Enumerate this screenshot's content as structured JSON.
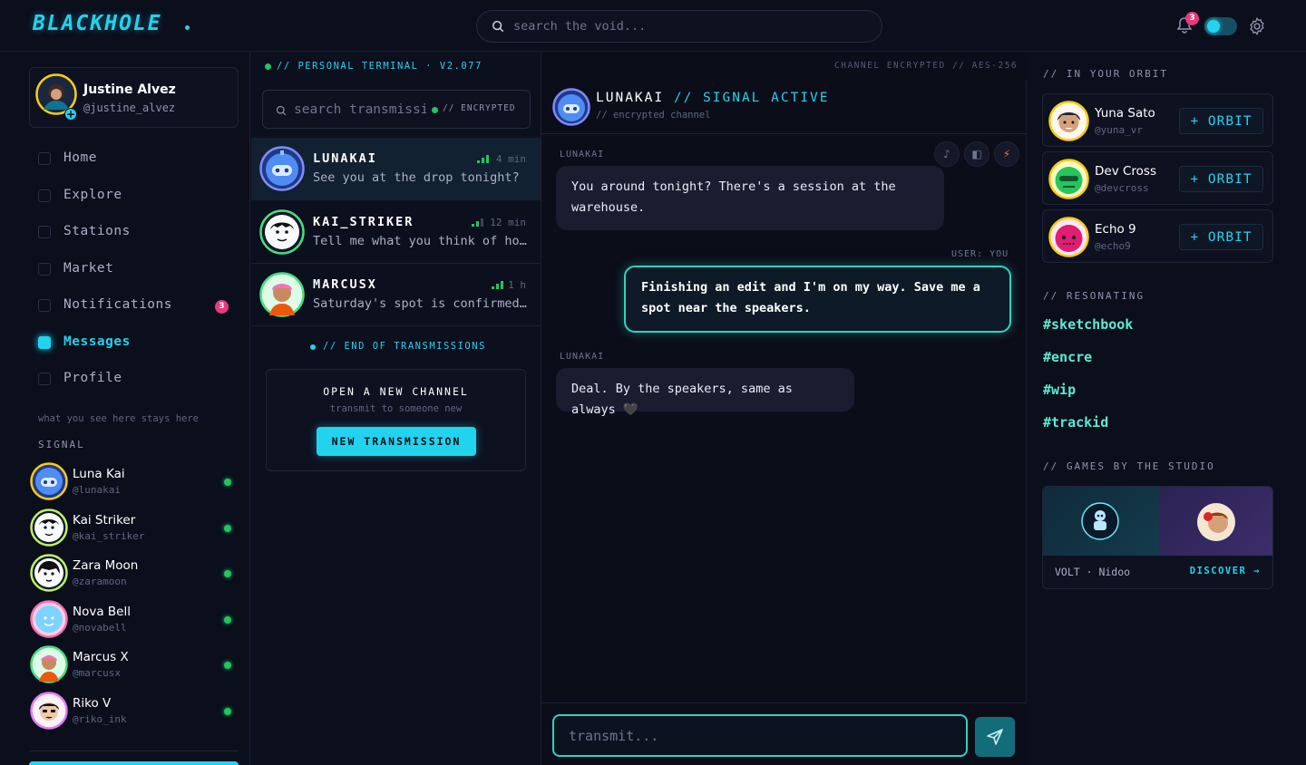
{
  "app": {
    "logo": "BLACKHOLE",
    "search_placeholder": "search the void...",
    "notification_count": "3",
    "theme_toggle": "on"
  },
  "profile": {
    "name": "Justine Alvez",
    "handle": "@justine_alvez"
  },
  "nav": {
    "items": [
      {
        "label": "Home"
      },
      {
        "label": "Explore"
      },
      {
        "label": "Stations"
      },
      {
        "label": "Market"
      },
      {
        "label": "Notifications",
        "badge": "3"
      },
      {
        "label": "Messages",
        "active": true
      },
      {
        "label": "Profile"
      }
    ]
  },
  "left_note": "what you see here stays here",
  "signal": {
    "heading": "SIGNAL",
    "users": [
      {
        "name": "Luna Kai",
        "handle": "@lunakai"
      },
      {
        "name": "Kai Striker",
        "handle": "@kai_striker"
      },
      {
        "name": "Zara Moon",
        "handle": "@zaramoon"
      },
      {
        "name": "Nova Bell",
        "handle": "@novabell"
      },
      {
        "name": "Marcus X",
        "handle": "@marcusx"
      },
      {
        "name": "Riko V",
        "handle": "@riko_ink"
      }
    ]
  },
  "threads": {
    "terminal_tag": "// PERSONAL TERMINAL · V2.077",
    "encryption_tag": "CHANNEL ENCRYPTED // AES-256",
    "search_placeholder": "search transmissions",
    "encrypted_label": "// ENCRYPTED",
    "items": [
      {
        "name": "LUNAKAI",
        "preview": "See you at the drop tonight?",
        "time": "4 min",
        "active": true
      },
      {
        "name": "KAI_STRIKER",
        "preview": "Tell me what you think of hour ...",
        "time": "12 min"
      },
      {
        "name": "MARCUSX",
        "preview": "Saturday's spot is confirmed, ...",
        "time": "1 h"
      }
    ],
    "end_label": "// END OF TRANSMISSIONS",
    "new_channel": {
      "title": "OPEN A NEW CHANNEL",
      "subtitle": "transmit to someone new",
      "button": "NEW TRANSMISSION"
    }
  },
  "chat": {
    "header_name": "LUNAKAI",
    "header_status": "// SIGNAL ACTIVE",
    "header_sub": "// encrypted channel",
    "messages": [
      {
        "sender": "LUNAKAI",
        "text": "You around tonight? There's a session at the warehouse.",
        "direction": "in"
      },
      {
        "sender": "USER: YOU",
        "text": "Finishing an edit and I'm on my way. Save me a spot near the speakers.",
        "direction": "out"
      },
      {
        "sender": "LUNAKAI",
        "text": "Deal. By the speakers, same as always 🖤",
        "direction": "in"
      }
    ],
    "composer_placeholder": "transmit..."
  },
  "right": {
    "orbit_heading": "// IN YOUR ORBIT",
    "orbit": [
      {
        "name": "Yuna Sato",
        "handle": "@yuna_vr",
        "button": "+ ORBIT"
      },
      {
        "name": "Dev Cross",
        "handle": "@devcross",
        "button": "+ ORBIT"
      },
      {
        "name": "Echo 9",
        "handle": "@echo9",
        "button": "+ ORBIT"
      }
    ],
    "resonating_heading": "// RESONATING",
    "tags": [
      "#sketchbook",
      "#encre",
      "#wip",
      "#trackid"
    ],
    "games_heading": "// GAMES BY THE STUDIO",
    "games": {
      "caption": "VOLT · Nidoo",
      "discover": "DISCOVER →"
    }
  },
  "colors": {
    "accent": "#22d3ee",
    "teal": "#2dd4bf",
    "online": "#22c55e",
    "badge": "#e83a7c",
    "background": "#0b0d19"
  }
}
